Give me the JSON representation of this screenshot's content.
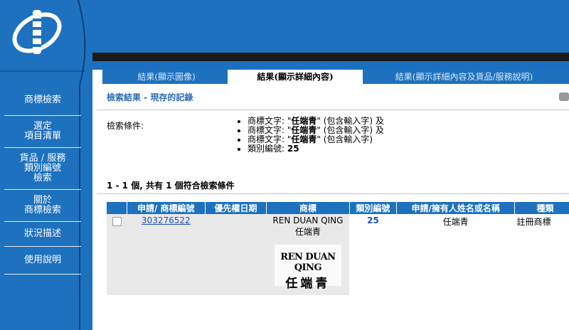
{
  "colors": {
    "brand_blue": "#1d71bf",
    "dark_band": "#1a1a1a",
    "link": "#1f4fc2",
    "heading": "#2a6bb6"
  },
  "sidebar": {
    "items": [
      {
        "label": "商標檢索"
      },
      {
        "label": "選定\n項目清單"
      },
      {
        "label": "貨品 / 服務\n類別編號\n檢索"
      },
      {
        "label": "關於\n商標檢索"
      },
      {
        "label": "狀況描述"
      },
      {
        "label": "使用說明"
      }
    ]
  },
  "tabs": {
    "image": "結果(顯示圖像)",
    "detail": "結果(顯示詳細內容)",
    "full": "結果(顯示詳細內容及貨品/服務說明)"
  },
  "main": {
    "title": "檢索結果 - 現存的記錄",
    "criteria_label": "檢索條件:",
    "criteria": [
      {
        "prefix": "商標文字: \"",
        "term": "任端青",
        "suffix": "\" (包含輸入字) 及"
      },
      {
        "prefix": "商標文字: \"",
        "term": "任端青",
        "suffix": "\" (包含輸入字) 及"
      },
      {
        "prefix": "商標文字: \"",
        "term": "任端青",
        "suffix": "\" (包含輸入字)"
      },
      {
        "prefix": "類別編號: ",
        "term": "25",
        "suffix": ""
      }
    ],
    "result_count": "1 - 1 個, 共有 1 個符合檢索條件"
  },
  "table": {
    "headers": [
      "",
      "申請/ 商標編號",
      "優先權日期",
      "商標",
      "類別編號",
      "申請/擁有人姓名或名稱",
      "種類"
    ],
    "rows": [
      {
        "app_no": "303276522",
        "priority": "",
        "mark_text": "REN DUAN QING 任端青",
        "mark_img_line1": "REN DUAN QING",
        "mark_img_line2": "任端青",
        "class_no": "25",
        "owner": "任端青",
        "type": "註冊商標"
      }
    ]
  }
}
